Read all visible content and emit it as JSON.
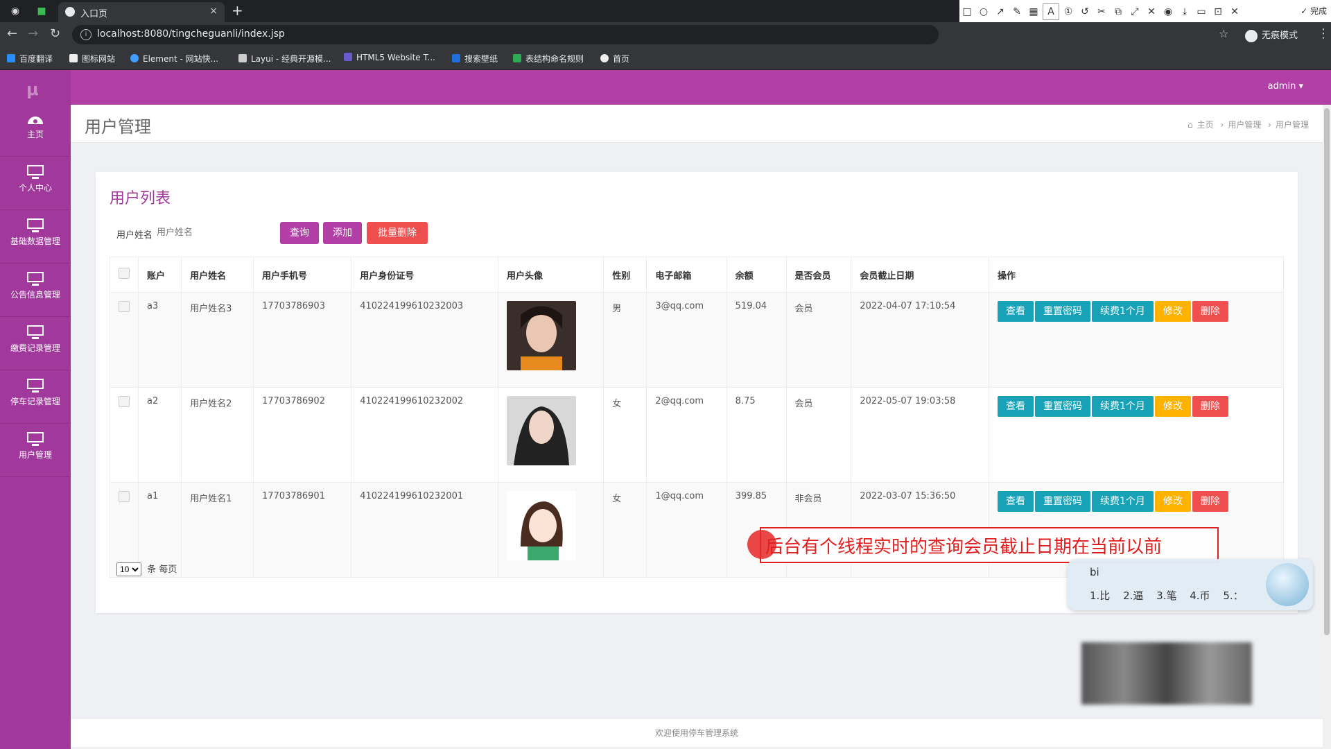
{
  "browser": {
    "tab_title": "入口页",
    "new_tab": "+",
    "close": "×",
    "url": "localhost:8080/tingcheguanli/index.jsp",
    "profile_label": "无痕模式",
    "bookmarks": [
      "百度翻译",
      "图标网站",
      "Element - 网站快...",
      "Layui - 经典开源模...",
      "HTML5 Website T...",
      "搜索壁纸",
      "表结构命名规则",
      "首页"
    ]
  },
  "annotation_tool": {
    "font_size": "20",
    "done_label": "完成",
    "selected_color": "#f23d3d",
    "palette": [
      "#000000",
      "#555555",
      "#7a1f1f",
      "#c0392b",
      "#e67e22",
      "#27ae60",
      "#2c3e9e",
      "#8e44ad",
      "#16a085",
      "#ffffff",
      "#999999",
      "#ff4d4d",
      "#f1c40f",
      "#2ecc71",
      "#3498db",
      "#9b59b6",
      "#e84393",
      "#1abc9c"
    ]
  },
  "app": {
    "logo": "μ",
    "admin": "admin",
    "sidebar": [
      {
        "label": "主页",
        "icon": "dashboard-icon"
      },
      {
        "label": "个人中心",
        "icon": "monitor-icon"
      },
      {
        "label": "基础数据管理",
        "icon": "monitor-icon"
      },
      {
        "label": "公告信息管理",
        "icon": "monitor-icon"
      },
      {
        "label": "缴费记录管理",
        "icon": "monitor-icon"
      },
      {
        "label": "停车记录管理",
        "icon": "monitor-icon"
      },
      {
        "label": "用户管理",
        "icon": "monitor-icon"
      }
    ],
    "page_title": "用户管理",
    "breadcrumb": [
      "主页",
      "用户管理",
      "用户管理"
    ],
    "card_title": "用户列表",
    "search": {
      "label": "用户姓名",
      "placeholder": "用户姓名"
    },
    "buttons": {
      "query": "查询",
      "add": "添加",
      "batch_delete": "批量删除"
    },
    "table": {
      "columns": [
        "账户",
        "用户姓名",
        "用户手机号",
        "用户身份证号",
        "用户头像",
        "性别",
        "电子邮箱",
        "余额",
        "是否会员",
        "会员截止日期",
        "操作"
      ],
      "rows": [
        {
          "account": "a3",
          "name": "用户姓名3",
          "phone": "17703786903",
          "id_card": "410224199610232003",
          "gender": "男",
          "email": "3@qq.com",
          "balance": "519.04",
          "member": "会员",
          "expire": "2022-04-07 17:10:54"
        },
        {
          "account": "a2",
          "name": "用户姓名2",
          "phone": "17703786902",
          "id_card": "410224199610232002",
          "gender": "女",
          "email": "2@qq.com",
          "balance": "8.75",
          "member": "会员",
          "expire": "2022-05-07 19:03:58"
        },
        {
          "account": "a1",
          "name": "用户姓名1",
          "phone": "17703786901",
          "id_card": "410224199610232001",
          "gender": "女",
          "email": "1@qq.com",
          "balance": "399.85",
          "member": "非会员",
          "expire": "2022-03-07 15:36:50"
        }
      ],
      "actions": [
        "查看",
        "重置密码",
        "续费1个月",
        "修改",
        "删除"
      ]
    },
    "pager": {
      "page_size": "10",
      "suffix": "条 每页"
    },
    "footer": "欢迎使用停车管理系统"
  },
  "overlay": {
    "note": "后台有个线程实时的查询会员截止日期在当前以前",
    "ime_code": "bi",
    "ime_candidates": "1.比 2.逼 3.笔 4.币 5.："
  }
}
